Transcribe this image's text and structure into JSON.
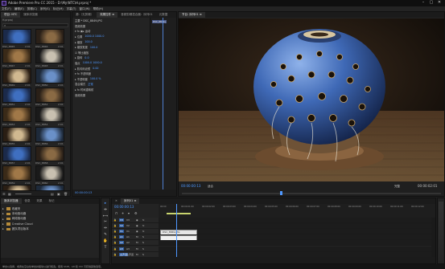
{
  "window": {
    "title": "Adobe Premiere Pro CC 2015 - D:\\My\\NTC\\H.prproj *"
  },
  "menu": [
    "文件(F)",
    "编辑(E)",
    "剪辑(C)",
    "序列(S)",
    "标记(M)",
    "字幕(T)",
    "窗口(W)",
    "帮助(H)"
  ],
  "project": {
    "tabs": [
      "项目: NTC",
      "媒体浏览器"
    ],
    "path": "H.prproj",
    "search_placeholder": "",
    "clips": [
      {
        "name": "DSC_8845",
        "dur": "2:01"
      },
      {
        "name": "DSC_8846",
        "dur": "2:01"
      },
      {
        "name": "DSC_8847",
        "dur": "2:01"
      },
      {
        "name": "DSC_8848",
        "dur": "2:01"
      },
      {
        "name": "DSC_8849",
        "dur": "2:01"
      },
      {
        "name": "DSC_8850",
        "dur": "2:01"
      },
      {
        "name": "DSC_8851",
        "dur": "2:01"
      },
      {
        "name": "DSC_8852",
        "dur": "2:01"
      },
      {
        "name": "DSC_8853",
        "dur": "2:01"
      },
      {
        "name": "DSC_8854",
        "dur": "2:01"
      },
      {
        "name": "DSC_8855",
        "dur": "2:01"
      },
      {
        "name": "DSC_8856",
        "dur": "2:01"
      },
      {
        "name": "DSC_8857",
        "dur": "2:01"
      },
      {
        "name": "DSC_8858",
        "dur": "2:01"
      },
      {
        "name": "DSC_8859",
        "dur": "2:01"
      },
      {
        "name": "DSC_8860",
        "dur": "2:01"
      },
      {
        "name": "DSC_8861",
        "dur": "2:01"
      },
      {
        "name": "DSC_8862",
        "dur": "2:01"
      }
    ]
  },
  "effect_controls": {
    "tabs": [
      "源:（无剪辑）",
      "效果控件 ≡",
      "音频剪辑混合器：序列01",
      "元数据"
    ],
    "clip_header": "主要 * DSC_8849.JPG",
    "clip_label": "DSC_8849.J",
    "rows": [
      {
        "label": "视频效果",
        "value": ""
      },
      {
        "label": "▾ fx ▣▸ 运动",
        "value": ""
      },
      {
        "label": "▸ 位置",
        "value": "1000.0   1000.0"
      },
      {
        "label": "▸ 缩放",
        "value": "100.0"
      },
      {
        "label": "▸ 缩放宽度",
        "value": "100.0"
      },
      {
        "label": "   ☑ 等比缩放",
        "value": ""
      },
      {
        "label": "▸ 旋转",
        "value": "0.0"
      },
      {
        "label": "   锚点",
        "value": "1000.0   1000.0"
      },
      {
        "label": "▸ 防闪烁滤镜",
        "value": "0.00"
      },
      {
        "label": "▾ fx 不透明度",
        "value": ""
      },
      {
        "label": "▸ 不透明度",
        "value": "100.0 %"
      },
      {
        "label": "   混合模式",
        "value": "正常"
      },
      {
        "label": "▸ fx 时间重映射",
        "value": ""
      },
      {
        "label": "音频效果",
        "value": ""
      }
    ],
    "timecode": "00:00:00:13"
  },
  "program": {
    "tabs": [
      "节目: 序列01 ≡"
    ],
    "timecode_left": "00:00:00:13",
    "fit": "适合",
    "quality": "完整",
    "timecode_right": "00:00:02:01",
    "transport": [
      "▾",
      "{",
      "}",
      "|◂",
      "◂|",
      "◂",
      "▶",
      "▸",
      "|▸",
      "▸|",
      "⊞",
      "▣",
      "◫"
    ]
  },
  "media_browser": {
    "tabs": [
      "媒体浏览器",
      "信息",
      "效果",
      "标记"
    ],
    "rows": [
      "收藏夹",
      "本地驱动器",
      "网络驱动器",
      "Creative Cloud",
      "团队项目版本"
    ]
  },
  "tools": [
    "▸",
    "⇹",
    "⟷",
    "✂",
    "⇔",
    "✎",
    "✋",
    "T"
  ],
  "timeline": {
    "tab": "序列01 ≡",
    "timecode": "00:00:00:13",
    "ticks": [
      "00:00",
      "00:00:01:00",
      "00:00:02:00",
      "00:00:03:00",
      "00:00:04:00",
      "00:00:05:00",
      "00:00:06:00",
      "00:00:07:00",
      "00:00:08:00",
      "00:00:09:00",
      "00:00:10:00",
      "00:00:11:00",
      "00:00:12:00"
    ],
    "tracks": [
      {
        "name": "V3",
        "type": "video"
      },
      {
        "name": "V2",
        "type": "video"
      },
      {
        "name": "V1",
        "type": "video",
        "clip": "DSC_8849.JPG"
      },
      {
        "name": "A1",
        "type": "audio",
        "clip": ""
      },
      {
        "name": "A2",
        "type": "audio"
      },
      {
        "name": "A3",
        "type": "audio"
      },
      {
        "name": "主声道",
        "type": "audio"
      }
    ]
  },
  "status": "单击以选择，或者在空白处单击并拖动以进行框选。使用 Shift、Alt 和 Ctrl 可获得其他选项。"
}
